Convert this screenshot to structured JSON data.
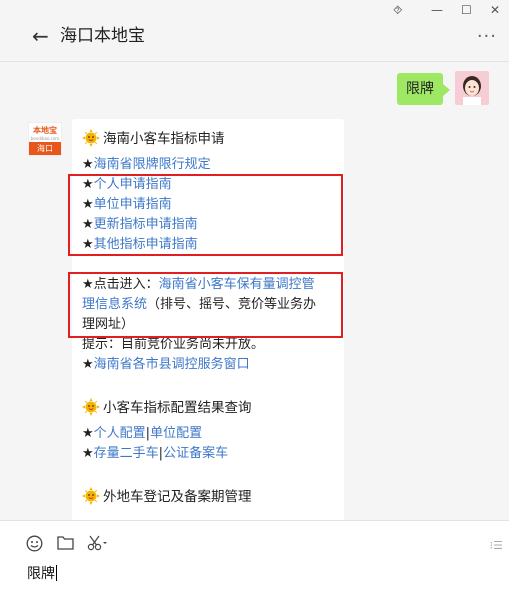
{
  "window": {
    "controls": [
      "⯑",
      "—",
      "☐",
      "✕"
    ]
  },
  "header": {
    "back": "←",
    "title": "海口本地宝",
    "more": "⋮"
  },
  "chat": {
    "user_message": "限牌",
    "bot_avatar": {
      "top": "本地宝",
      "bottom": "海口"
    },
    "card": {
      "section1_title": "海南小客车指标申请",
      "items": [
        "海南省限牌限行规定",
        "个人申请指南",
        "单位申请指南",
        "更新指标申请指南",
        "其他指标申请指南"
      ],
      "star": "★",
      "entry_prefix": "点击进入：",
      "entry_link_line1": "海南省小客车保有量调控管",
      "entry_link_line2": "理信息系统",
      "entry_tail_line2": "（排号、摇号、竞价等业务办",
      "entry_tail_line3": "理网址）",
      "notice": "提示：目前竞价业务尚未开放。",
      "service_link": "海南省各市县调控服务窗口",
      "section2_title": "小客车指标配置结果查询",
      "personal_config": "个人配置",
      "unit_config": "单位配置",
      "sep": "|",
      "used_car": "存量二手车",
      "notary_car": "公证备案车",
      "section3_title": "外地车登记及备案期管理"
    }
  },
  "inputbar": {
    "text": "限牌",
    "send_hint": "⁝☰"
  },
  "icons": [
    "back-arrow-icon",
    "more-icon",
    "sun-emoji-icon",
    "emoji-icon",
    "folder-icon",
    "scissors-icon"
  ],
  "colors": {
    "link": "#3d78c8",
    "bubble": "#9fe864",
    "highlight": "#e02020",
    "brand": "#e8561b"
  }
}
